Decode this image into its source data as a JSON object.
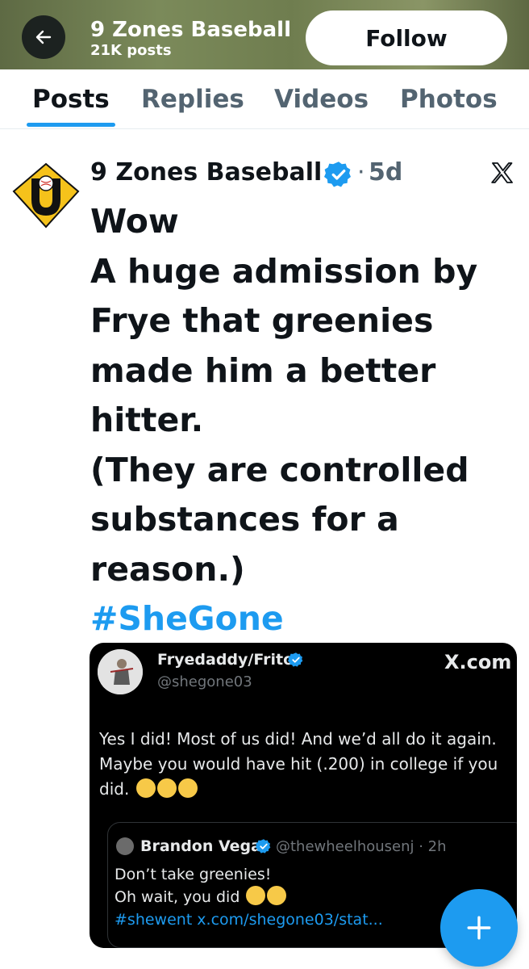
{
  "header": {
    "title": "9 Zones Baseball",
    "post_count": "21K posts",
    "follow_label": "Follow"
  },
  "tabs": [
    {
      "label": "Posts",
      "active": true
    },
    {
      "label": "Replies",
      "active": false
    },
    {
      "label": "Videos",
      "active": false
    },
    {
      "label": "Photos",
      "active": false
    }
  ],
  "post": {
    "author": "9 Zones Baseball",
    "separator": "·",
    "time": "5d",
    "lines": [
      "Wow",
      "A huge admission by",
      "Frye that greenies",
      "made him a better",
      "hitter.",
      "(They are controlled",
      "substances for a",
      "reason.)"
    ],
    "hashtag": "#SheGone"
  },
  "embedded": {
    "name": "Fryedaddy/Frito",
    "handle": "@shegone03",
    "source": "X.com",
    "lines": [
      "Yes I did! Most of us did! And we’d all do it again.",
      "Maybe you would have hit (.200) in college if you",
      "did."
    ],
    "quote": {
      "name": "Brandon Vega",
      "handle": "@thewheelhousenj · 2h",
      "line1": "Don’t take greenies!",
      "line2": "Oh wait, you did",
      "link": "#shewent x.com/shegone03/stat..."
    }
  },
  "icons": {
    "back": "arrow-left-icon",
    "verified": "verified-badge-icon",
    "x_logo": "x-logo-icon",
    "compose": "plus-icon",
    "emoji_laugh": "tears-of-joy-emoji-icon",
    "emoji_wink": "winking-face-emoji-icon"
  },
  "colors": {
    "accent": "#1d9bf0",
    "text": "#0f1419",
    "secondary": "#536471"
  }
}
